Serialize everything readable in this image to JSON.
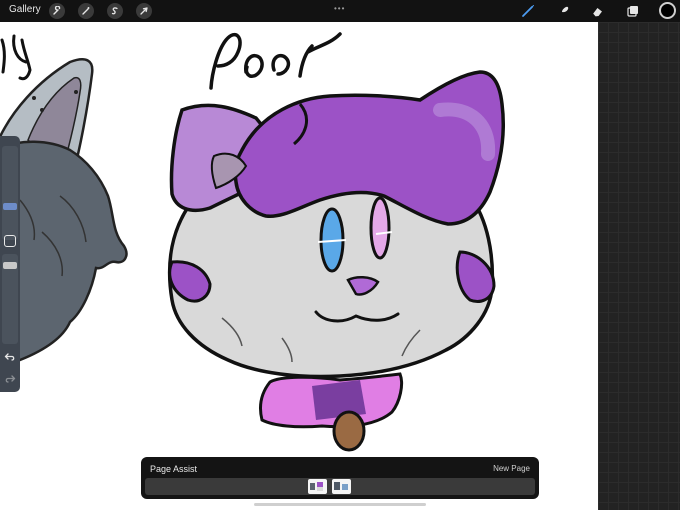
{
  "topbar": {
    "gallery_label": "Gallery",
    "left_tools": [
      "wrench-icon",
      "magic-wand-icon",
      "selection-icon",
      "transform-arrow-icon"
    ],
    "right_tools": [
      "brush-icon",
      "smudge-icon",
      "eraser-icon",
      "layers-icon"
    ],
    "active_tool": "brush",
    "grip": "•••"
  },
  "canvas": {
    "lettering": "Poor",
    "partial_lettering": "ty"
  },
  "sidebar": {
    "controls": [
      "brush-size-slider",
      "modify-button",
      "brush-opacity-slider",
      "undo-button",
      "redo-button"
    ]
  },
  "page_assist": {
    "title": "Page Assist",
    "new_page_label": "New Page",
    "pages": 2
  },
  "colors": {
    "accent_active": "#4c9cf2",
    "current_color": "#000000",
    "cat_purple": "#9c52c6",
    "cat_light_purple": "#b889d6",
    "cat_grey": "#d9d9d9",
    "wolf_grey": "#5c656f",
    "collar_pink": "#e07ee4",
    "bell_brown": "#9a6a43"
  }
}
